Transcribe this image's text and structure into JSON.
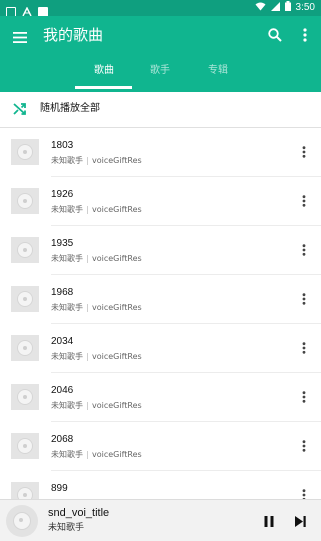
{
  "status_bar": {
    "time": "3:50",
    "icons": [
      "notification-square-icon",
      "signal-icon",
      "image-icon",
      "wifi-icon",
      "cell-signal-icon",
      "battery-icon"
    ]
  },
  "app_bar": {
    "title": "我的歌曲",
    "menu_icon": "menu-icon",
    "search_icon": "search-icon",
    "more_icon": "more-vert-icon",
    "color": "#10b58f",
    "status_color": "#0f9f7f"
  },
  "tabs": [
    {
      "label": "歌曲",
      "selected": true
    },
    {
      "label": "歌手",
      "selected": false
    },
    {
      "label": "专辑",
      "selected": false
    }
  ],
  "shuffle": {
    "label": "随机播放全部",
    "icon": "shuffle-icon",
    "accent": "#10b58f"
  },
  "songs": [
    {
      "title": "1803",
      "artist": "未知歌手",
      "album": "voiceGiftRes"
    },
    {
      "title": "1926",
      "artist": "未知歌手",
      "album": "voiceGiftRes"
    },
    {
      "title": "1935",
      "artist": "未知歌手",
      "album": "voiceGiftRes"
    },
    {
      "title": "1968",
      "artist": "未知歌手",
      "album": "voiceGiftRes"
    },
    {
      "title": "2034",
      "artist": "未知歌手",
      "album": "voiceGiftRes"
    },
    {
      "title": "2046",
      "artist": "未知歌手",
      "album": "voiceGiftRes"
    },
    {
      "title": "2068",
      "artist": "未知歌手",
      "album": "voiceGiftRes"
    },
    {
      "title": "899",
      "artist": "",
      "album": ""
    }
  ],
  "player": {
    "title": "snd_voi_title",
    "artist": "未知歌手",
    "pause_icon": "pause-icon",
    "next_icon": "skip-next-icon"
  }
}
